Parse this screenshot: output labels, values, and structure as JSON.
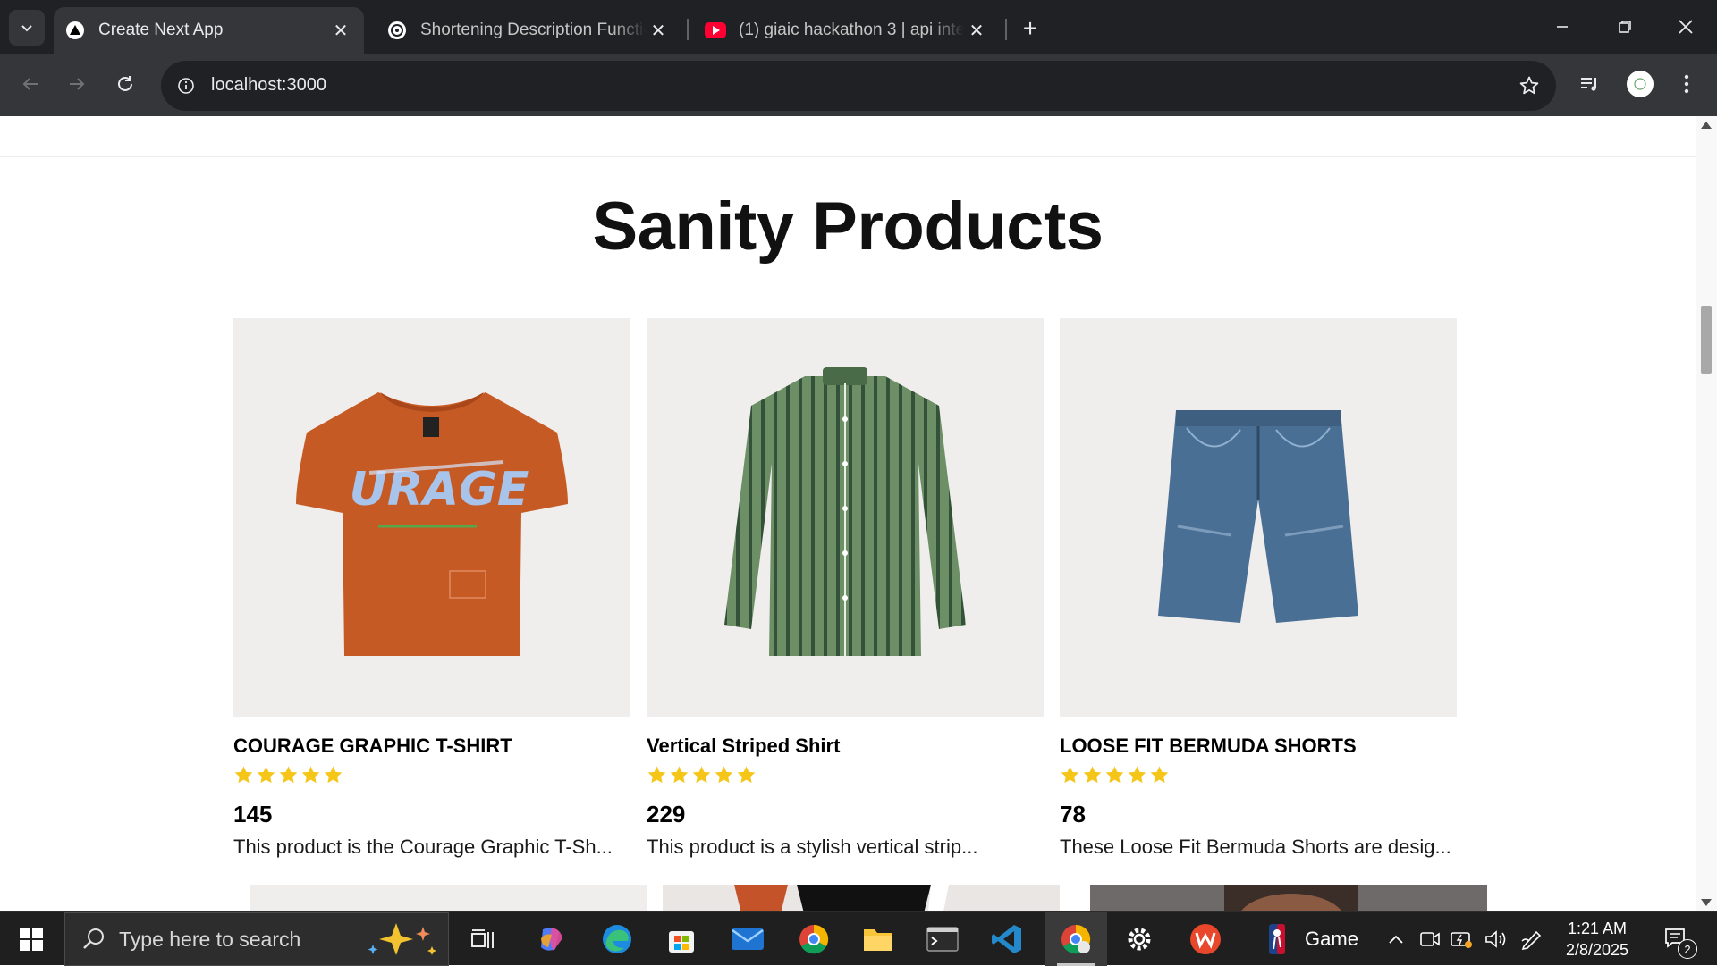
{
  "browser": {
    "tabs": [
      {
        "title": "Create Next App",
        "active": true
      },
      {
        "title": "Shortening Description Function",
        "active": false
      },
      {
        "title": "(1) giaic hackathon 3 | api integ",
        "active": false
      }
    ],
    "url": "localhost:3000"
  },
  "page": {
    "heading": "Sanity Products",
    "products": [
      {
        "name": "COURAGE GRAPHIC T-SHIRT",
        "rating": 5,
        "price": "145",
        "description": "This product is the Courage Graphic T-Sh..."
      },
      {
        "name": "Vertical Striped Shirt",
        "rating": 5,
        "price": "229",
        "description": "This product is a stylish vertical strip..."
      },
      {
        "name": "LOOSE FIT BERMUDA SHORTS",
        "rating": 5,
        "price": "78",
        "description": "These Loose Fit Bermuda Shorts are desig..."
      }
    ],
    "tshirt_print": "URAGE"
  },
  "taskbar": {
    "search_placeholder": "Type here to search",
    "game_label": "Game",
    "time": "1:21 AM",
    "date": "2/8/2025",
    "notification_count": "2"
  },
  "colors": {
    "tshirt": "#c65a24",
    "shirt": "#5f7f5a",
    "shorts": "#4a6f94",
    "star": "#f5c518"
  }
}
